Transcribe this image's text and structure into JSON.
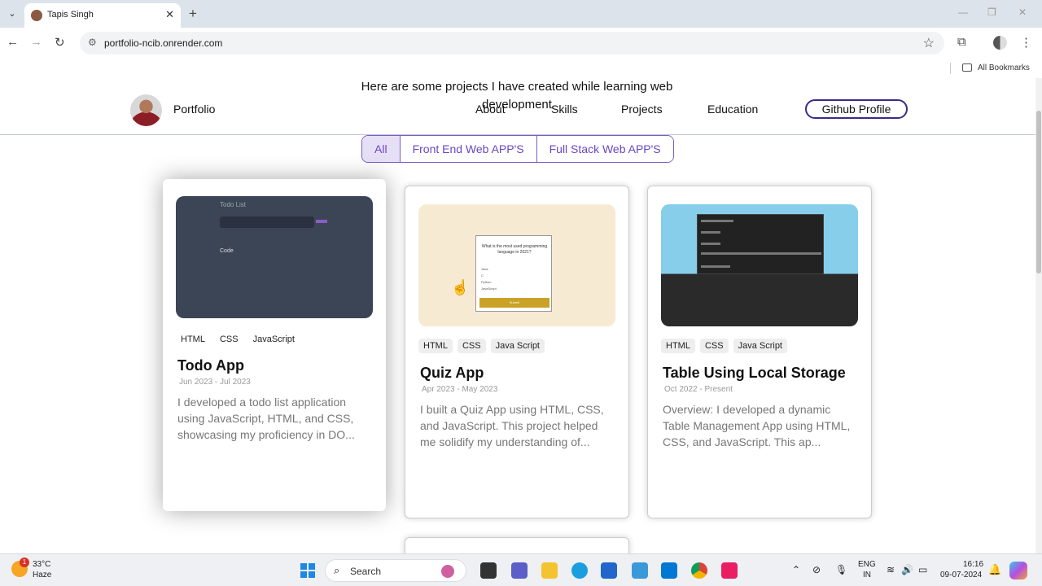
{
  "browser": {
    "tab_title": "Tapis Singh",
    "tab_close": "✕",
    "new_tab": "+",
    "url": "portfolio-ncib.onrender.com",
    "bookmarks_label": "All Bookmarks"
  },
  "page": {
    "subtitle": "Here are some projects I have created while learning web development",
    "logo_text": "Portfolio",
    "nav": [
      "About",
      "Skills",
      "Projects",
      "Education"
    ],
    "github_button": "Github Profile",
    "filters": [
      {
        "label": "All",
        "active": true
      },
      {
        "label": "Front End Web APP'S",
        "active": false
      },
      {
        "label": "Full Stack Web APP'S",
        "active": false
      }
    ],
    "projects": [
      {
        "tags": [
          "HTML",
          "CSS",
          "JavaScript"
        ],
        "title": "Todo App",
        "date": "Jun 2023 - Jul 2023",
        "description": "I developed a todo list application using JavaScript, HTML, and CSS, showcasing my proficiency in DO...",
        "thumb": {
          "heading": "Todo List",
          "item": "Code"
        }
      },
      {
        "tags": [
          "HTML",
          "CSS",
          "Java Script"
        ],
        "title": "Quiz App",
        "date": "Apr 2023 - May 2023",
        "description": "I built a Quiz App using HTML, CSS, and JavaScript. This project helped me solidify my understanding of...",
        "thumb": {
          "question": "What is the most used programming language in 2021?",
          "options": [
            "Java",
            "C",
            "Python",
            "JavaScript"
          ],
          "submit": "Submit"
        }
      },
      {
        "tags": [
          "HTML",
          "CSS",
          "Java Script"
        ],
        "title": "Table Using Local Storage",
        "date": "Oct 2022 - Present",
        "description": "Overview: I developed a dynamic Table Management App using HTML, CSS, and JavaScript. This ap..."
      }
    ]
  },
  "taskbar": {
    "weather_badge": "1",
    "temperature": "33°C",
    "weather": "Haze",
    "search_placeholder": "Search",
    "lang_top": "ENG",
    "lang_bottom": "IN",
    "time": "16:16",
    "date": "09-07-2024"
  }
}
